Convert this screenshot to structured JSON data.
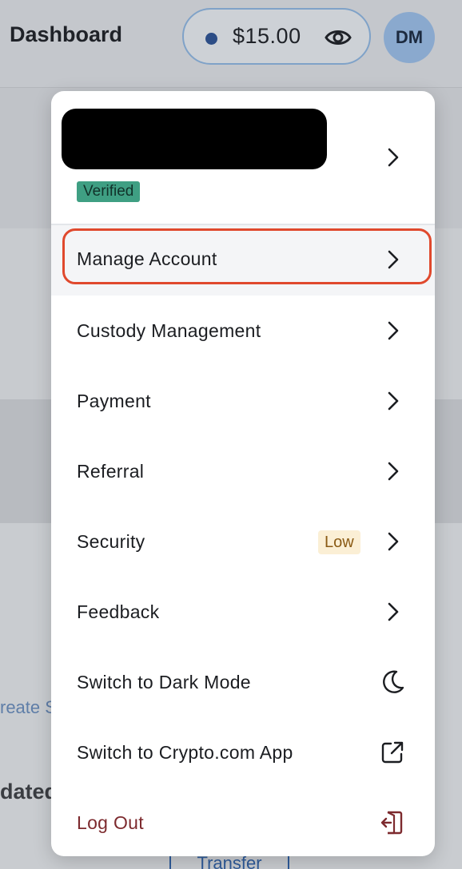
{
  "header": {
    "title": "Dashboard",
    "balance": "$15.00",
    "avatar_initials": "DM",
    "icons": {
      "balance_visibility": "eye-icon"
    },
    "colors": {
      "balance_dot": "#2c4d86",
      "avatar_bg": "#8aa9ce",
      "pill_border": "#7fa2c8"
    }
  },
  "background": {
    "link_fragment": "reate S",
    "heading_fragment": "dated",
    "button_fragment": "Transfer"
  },
  "menu": {
    "account": {
      "name_redacted": true,
      "status_badge": "Verified"
    },
    "items": [
      {
        "label": "Manage Account",
        "icon": "chevron-right-icon",
        "highlighted": true
      },
      {
        "label": "Custody Management",
        "icon": "chevron-right-icon"
      },
      {
        "label": "Payment",
        "icon": "chevron-right-icon"
      },
      {
        "label": "Referral",
        "icon": "chevron-right-icon"
      },
      {
        "label": "Security",
        "icon": "chevron-right-icon",
        "badge": "Low"
      },
      {
        "label": "Feedback",
        "icon": "chevron-right-icon"
      },
      {
        "label": "Switch to Dark Mode",
        "icon": "moon-icon"
      },
      {
        "label": "Switch to Crypto.com App",
        "icon": "external-link-icon"
      },
      {
        "label": "Log Out",
        "icon": "logout-icon"
      }
    ],
    "colors": {
      "highlight_ring": "#e0492d",
      "verified_badge": "#3f9f83",
      "low_badge_bg": "#fbefd5",
      "logout_text": "#7d2a2e"
    }
  }
}
